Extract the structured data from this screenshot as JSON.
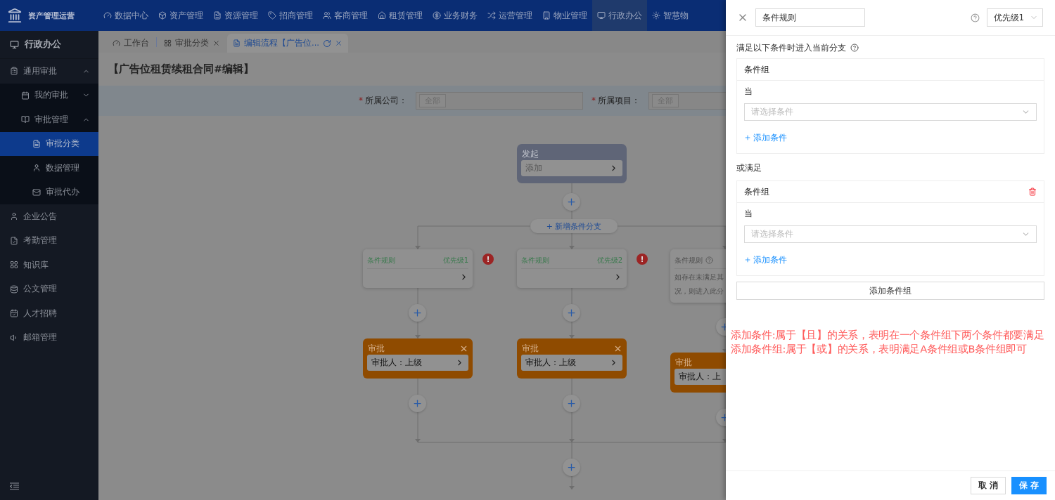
{
  "app": {
    "logo_text": "资产管理运营"
  },
  "top_nav": [
    {
      "label": "数据中心",
      "selected": false
    },
    {
      "label": "资产管理",
      "selected": false
    },
    {
      "label": "资源管理",
      "selected": false
    },
    {
      "label": "招商管理",
      "selected": false
    },
    {
      "label": "客商管理",
      "selected": false
    },
    {
      "label": "租赁管理",
      "selected": false
    },
    {
      "label": "业务财务",
      "selected": false
    },
    {
      "label": "运营管理",
      "selected": false
    },
    {
      "label": "物业管理",
      "selected": false
    },
    {
      "label": "行政办公",
      "selected": true
    },
    {
      "label": "智慧物",
      "selected": false
    }
  ],
  "sidebar": {
    "header": "行政办公",
    "items": [
      {
        "label": "通用审批",
        "selected": false,
        "expanded": true,
        "children": [
          {
            "label": "我的审批",
            "selected": false,
            "expanded": false
          },
          {
            "label": "审批管理",
            "selected": false,
            "expanded": true,
            "children": [
              {
                "label": "审批分类",
                "selected": true
              },
              {
                "label": "数据管理",
                "selected": false
              },
              {
                "label": "审批代办",
                "selected": false
              }
            ]
          }
        ]
      },
      {
        "label": "企业公告",
        "selected": false
      },
      {
        "label": "考勤管理",
        "selected": false
      },
      {
        "label": "知识库",
        "selected": false
      },
      {
        "label": "公文管理",
        "selected": false
      },
      {
        "label": "人才招聘",
        "selected": false
      },
      {
        "label": "邮箱管理",
        "selected": false
      }
    ]
  },
  "tabs": [
    {
      "label": "工作台",
      "selected": false,
      "closable": false
    },
    {
      "label": "审批分类",
      "selected": false,
      "closable": true
    },
    {
      "label": "编辑流程【广告位...",
      "selected": true,
      "closable": true
    }
  ],
  "page_title": "【广告位租赁续租合同#编辑】",
  "filters": [
    {
      "label": "所属公司：",
      "required_mark": "*",
      "value": "全部"
    },
    {
      "label": "所属项目：",
      "required_mark": "*",
      "value": "全部"
    }
  ],
  "flow": {
    "start": {
      "title": "发起",
      "action": "添加"
    },
    "add_branch": "+ 新增条件分支",
    "branches": [
      {
        "kind": "condition",
        "title": "条件规则",
        "priority": "优先级1",
        "error_badge": "!",
        "approval": {
          "title": "审批",
          "approver": "审批人：上级"
        }
      },
      {
        "kind": "condition",
        "title": "条件规则",
        "priority": "优先级2",
        "error_badge": "!",
        "approval": {
          "title": "审批",
          "approver": "审批人：上级"
        }
      },
      {
        "kind": "default",
        "title": "条件规则",
        "description_lines": [
          "如存在未满足其",
          "况，则进入此分"
        ],
        "approval": {
          "title": "审批",
          "approver": "审批人：上"
        }
      }
    ]
  },
  "drawer": {
    "name_value": "条件规则",
    "priority": "优先级1",
    "intro": "满足以下条件时进入当前分支",
    "or_label": "或满足",
    "groups": [
      {
        "title": "条件组",
        "deletable": false,
        "when_label": "当",
        "condition_placeholder": "请选择条件",
        "add_condition": "添加条件"
      },
      {
        "title": "条件组",
        "deletable": true,
        "when_label": "当",
        "condition_placeholder": "请选择条件",
        "add_condition": "添加条件"
      }
    ],
    "add_group": "添加条件组",
    "note_lines": [
      "添加条件:属于【且】的关系，表明在一个条件组下两个条件都要满足",
      "添加条件组:属于【或】的关系，表明满足A条件组或B条件组即可"
    ],
    "cancel": "取 消",
    "save": "保 存"
  }
}
